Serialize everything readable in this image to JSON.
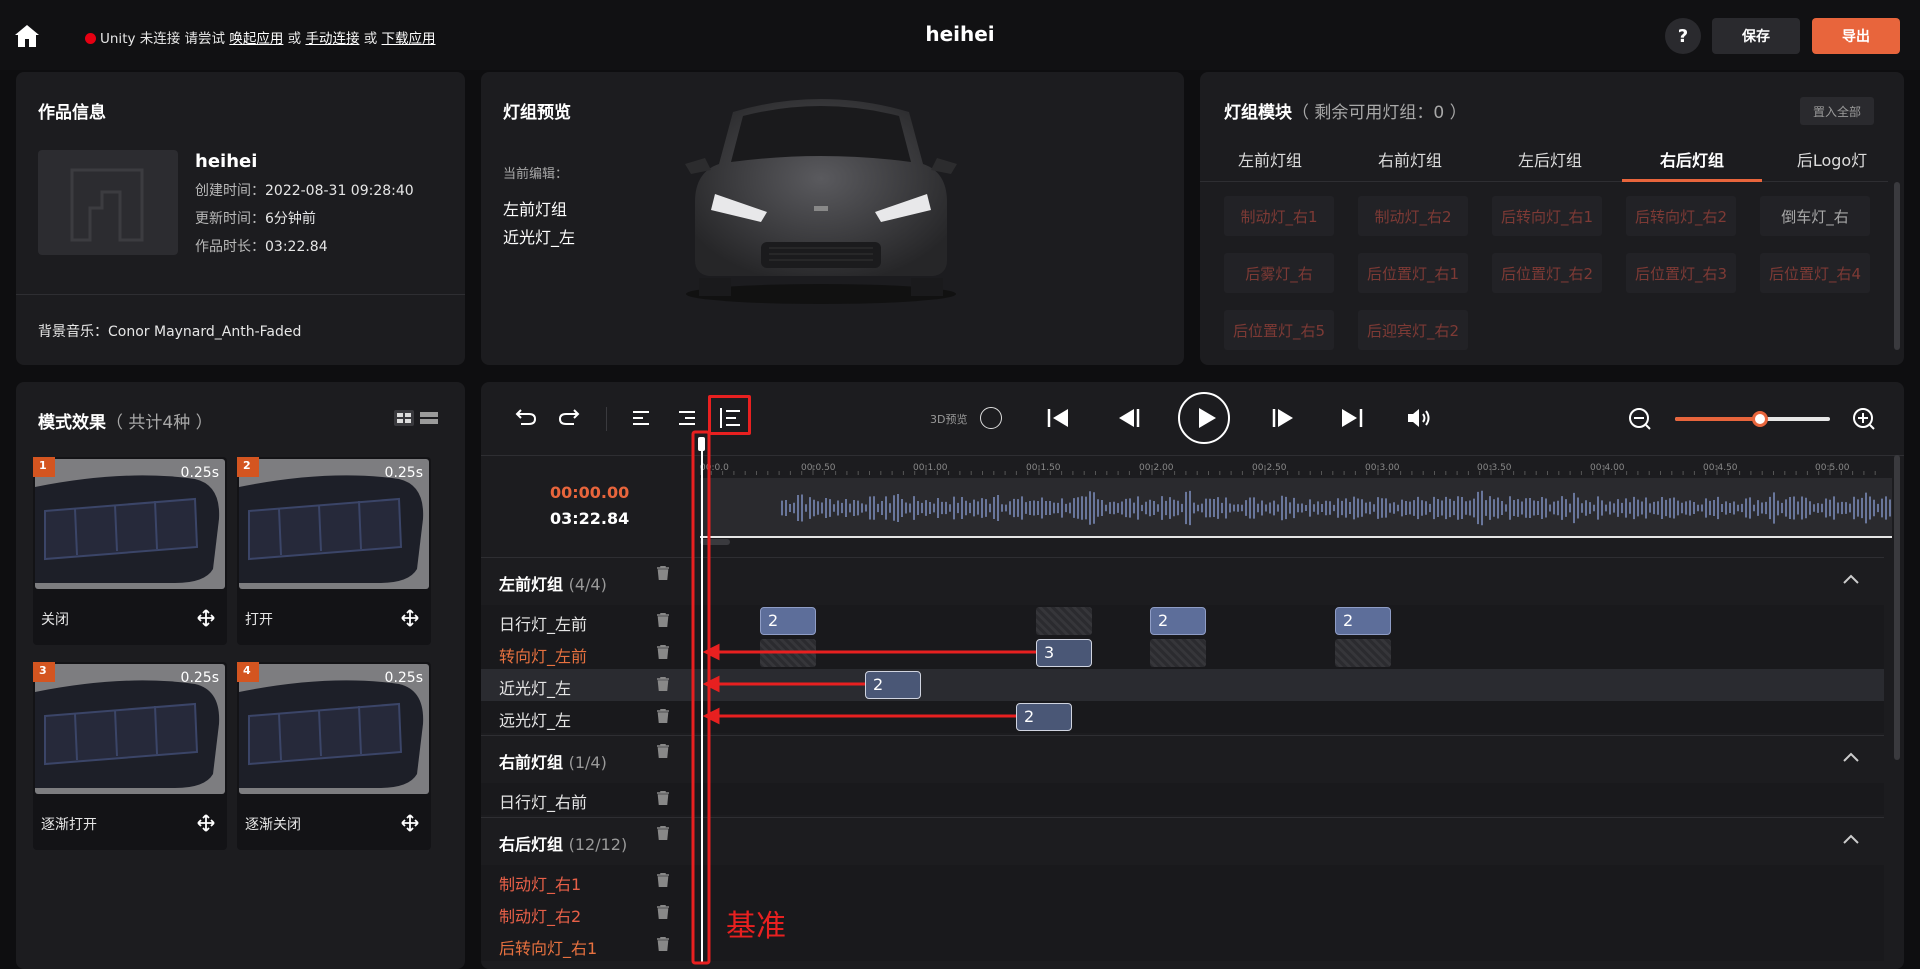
{
  "header": {
    "unity_prefix": "Unity 未连接 请尝试",
    "link_wake": "唤起应用",
    "or1": "或",
    "link_manual": "手动连接",
    "or2": "或",
    "link_download": "下载应用",
    "title": "heihei",
    "help": "?",
    "save": "保存",
    "export": "导出"
  },
  "work_info": {
    "title": "作品信息",
    "name": "heihei",
    "created_label": "创建时间：",
    "created": "2022-08-31 09:28:40",
    "updated_label": "更新时间：",
    "updated": "6分钟前",
    "duration_label": "作品时长：",
    "duration": "03:22.84",
    "music_label": "背景音乐：",
    "music": "Conor Maynard_Anth-Faded"
  },
  "preview": {
    "title": "灯组预览",
    "current_label": "当前编辑：",
    "current_group": "左前灯组",
    "current_light": "近光灯_左"
  },
  "modules": {
    "title": "灯组模块",
    "remaining": "（ 剩余可用灯组：0 ）",
    "set_all": "置入全部",
    "tabs": [
      "左前灯组",
      "右前灯组",
      "左后灯组",
      "右后灯组",
      "后Logo灯"
    ],
    "active_tab": 3,
    "chips": [
      "制动灯_右1",
      "制动灯_右2",
      "后转向灯_右1",
      "后转向灯_右2",
      "倒车灯_右",
      "后雾灯_右",
      "后位置灯_右1",
      "后位置灯_右2",
      "后位置灯_右3",
      "后位置灯_右4",
      "后位置灯_右5",
      "后迎宾灯_右2"
    ]
  },
  "patterns": {
    "title": "模式效果",
    "count": "（ 共计4种 ）",
    "cards": [
      {
        "num": "1",
        "time": "0.25s",
        "label": "关闭"
      },
      {
        "num": "2",
        "time": "0.25s",
        "label": "打开"
      },
      {
        "num": "3",
        "time": "0.25s",
        "label": "逐渐打开"
      },
      {
        "num": "4",
        "time": "0.25s",
        "label": "逐渐关闭"
      }
    ]
  },
  "timeline": {
    "preview_3d": "3D预览",
    "current_time": "00:00.00",
    "total_time": "03:22.84",
    "zoom_level": 0.55,
    "ruler": [
      "00:0.0",
      "00:0.50",
      "00:1.00",
      "00:1.50",
      "00:2.00",
      "00:2.50",
      "00:3.00",
      "00:3.50",
      "00:4.00",
      "00:4.50",
      "00:5.00"
    ],
    "groups": [
      {
        "name": "左前灯组",
        "count": "(4/4)",
        "tracks": [
          "日行灯_左前",
          "转向灯_左前",
          "近光灯_左",
          "远光灯_左"
        ]
      },
      {
        "name": "右前灯组",
        "count": "(1/4)",
        "tracks": [
          "日行灯_右前"
        ]
      },
      {
        "name": "右后灯组",
        "count": "(12/12)",
        "tracks": [
          "制动灯_右1",
          "制动灯_右2",
          "后转向灯_右1"
        ]
      }
    ],
    "clip_labels": [
      "2",
      "2",
      "2",
      "3",
      "2",
      "2"
    ],
    "annotation": "基准"
  },
  "colors": {
    "accent": "#e8653c",
    "unity_dot": "#e60012",
    "annotation": "#e82020",
    "clip": "#5d6e9a"
  }
}
